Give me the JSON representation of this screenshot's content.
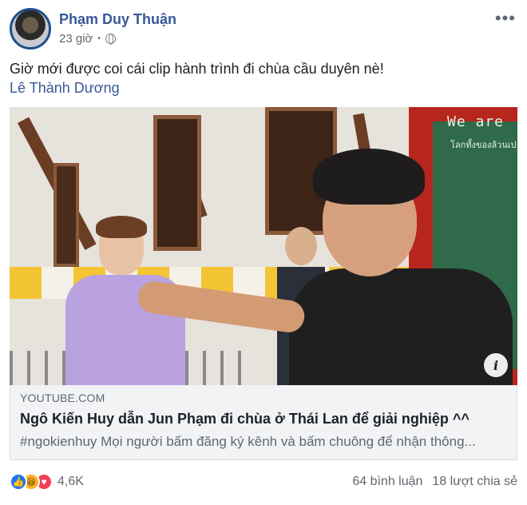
{
  "post": {
    "author": "Phạm Duy Thuận",
    "time": "23 giờ",
    "privacy_icon": "globe-icon",
    "text": "Giờ mới được coi cái clip hành trình đi chùa cầu duyên nè!",
    "mention": "Lê Thành Dương"
  },
  "video": {
    "sign_title": "We are",
    "sign_subtitle": "โลกทั้งของล้วนเป",
    "info_icon": "i"
  },
  "link": {
    "domain": "YOUTUBE.COM",
    "title": "Ngô Kiến Huy dẫn Jun Phạm đi chùa ở Thái Lan để giải nghiệp ^^",
    "description": "#ngokienhuy Mọi người bấm đăng ký kênh và bấm chuông để nhận thông..."
  },
  "footer": {
    "reaction_count": "4,6K",
    "comments": "64 bình luận",
    "shares": "18 lượt chia sẻ",
    "reaction_icons": [
      "like-icon",
      "haha-icon",
      "love-icon"
    ]
  },
  "colors": {
    "author_blue": "#385898",
    "like_blue": "#1877f2",
    "love_red": "#f33e58",
    "haha_yellow": "#f7b125"
  }
}
